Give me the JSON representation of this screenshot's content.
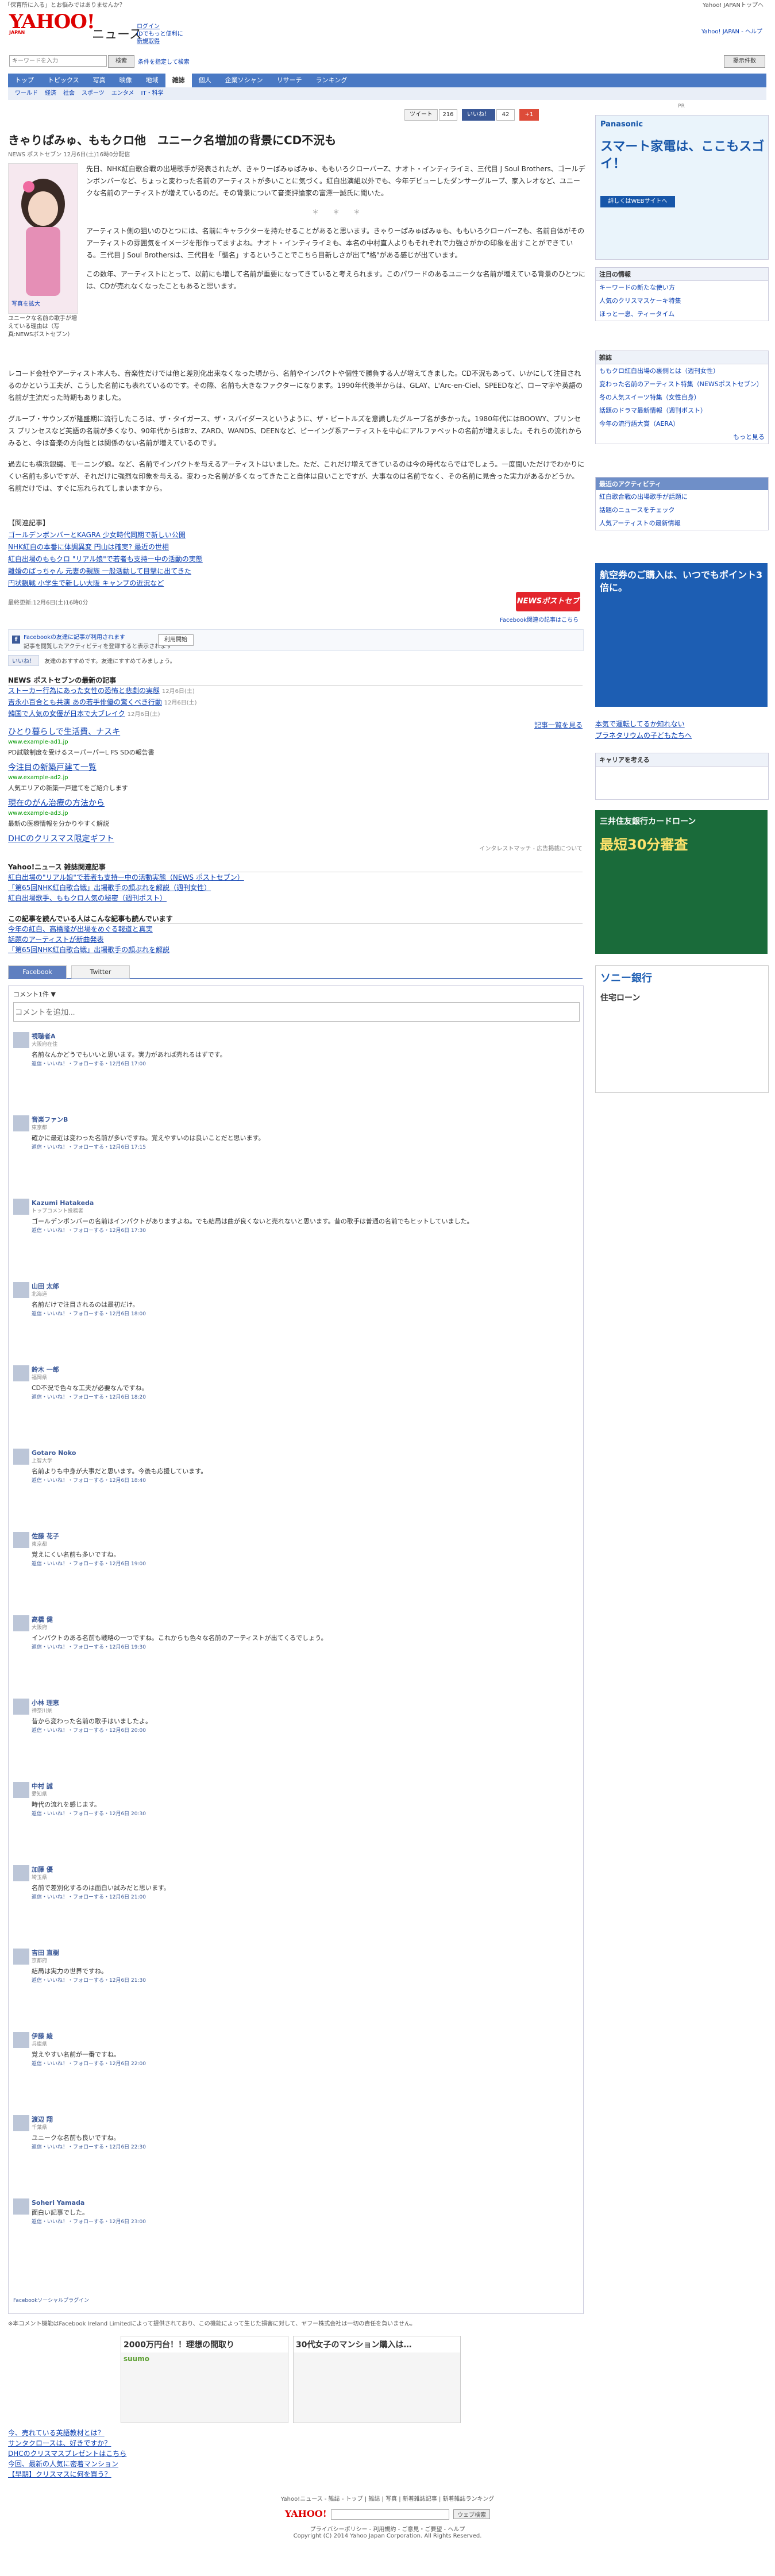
{
  "top_strip": {
    "left": "「保育所に入る」とお悩みではありませんか？",
    "right": "Yahoo! JAPANトップへ"
  },
  "header": {
    "logo": "YAHOO!",
    "logo_sub": "JAPAN",
    "section_title": "ニュース",
    "login": "ログイン",
    "login_sub": "IDでもっと便利に",
    "register": "新規取得",
    "right_links": "Yahoo! JAPAN - ヘルプ",
    "search_placeholder": "キーワードを入力",
    "search_button": "検索",
    "search_option": "条件を指定して検索",
    "search_right_button": "提示件数"
  },
  "nav": {
    "tabs": [
      "トップ",
      "トピックス",
      "写真",
      "映像",
      "地域",
      "雑誌",
      "個人",
      "企業ソシャン",
      "リサーチ",
      "ランキング"
    ],
    "active_index": 5,
    "sub": [
      "ワールド",
      "経済",
      "社会",
      "スポーツ",
      "エンタメ",
      "IT・科学"
    ]
  },
  "share": {
    "tweet": "ツイート",
    "tweet_count": "216",
    "like": "いいね！",
    "like_count": "42",
    "gplus": "+1"
  },
  "article": {
    "title": "きゃりぱみゅ、ももクロ他　ユニーク名増加の背景にCD不況も",
    "source": "NEWS ポストセブン 12月6日(土)16時0分配信",
    "caption": "ユニークな名前の歌手が増えている理由は（写真:NEWSポストセブン）",
    "photo_alt": "写真を拡大",
    "paras": [
      "先日、NHK紅白歌合戦の出場歌手が発表されたが、きゃりーぱみゅぱみゅ、ももいろクローバーZ、ナオト・インティライミ、三代目 J Soul Brothers、ゴールデンボンバーなど、ちょっと変わった名前のアーティストが多いことに気づく。紅白出演組以外でも、今年デビューしたダンサーグループ、家入レオなど、ユニークな名前のアーティストが増えているのだ。その背景について音楽評論家の富澤一誠氏に聞いた。",
      "アーティスト側の狙いのひとつには、名前にキャラクターを持たせることがあると思います。きゃりーぱみゅぱみゅも、ももいろクローバーZも、名前自体がそのアーティストの雰囲気をイメージを形作ってますよね。ナオト・インティライミも、本名の中村直人よりもそれぞれで力強さがかの印象を出すことができている。三代目 J Soul Brothersは、三代目を「襲名」するということでこちら目新しさが出て\"格\"がある感じが出ています。",
      "この数年、アーティストにとって、以前にも増して名前が重要になってきていると考えられます。このパワードのあるユニークな名前が増えている背景のひとつには、CDが売れなくなったこともあると思います。",
      "レコード会社やアーティスト本人も、音楽性だけでは他と差別化出来なくなった頃から、名前やインパクトや個性で勝負する人が増えてきました。CD不況もあって、いかにして注目されるのかという工夫が、こうした名前にも表れているのです。その際、名前も大きなファクターになります。1990年代後半からは、GLAY、L'Arc-en-Ciel、SPEEDなど、ローマ字や英語の名前が主流だった時期もありました。",
      "グループ・サウンズが隆盛期に流行したころは、ザ・タイガース、ザ・スパイダースというように、ザ・ビートルズを意識したグループ名が多かった。1980年代にはBOOWY、プリンセス プリンセスなど英語の名前が多くなり、90年代からはB'z、ZARD、WANDS、DEENなど、ビーイング系アーティストを中心にアルファベットの名前が増えました。それらの流れからみると、今は音楽の方向性とは関係のない名前が増えているのです。",
      "過去にも横浜銀蝿、モーニング娘。など、名前でインパクトを与えるアーティストはいました。ただ、これだけ増えてきているのは今の時代ならではでしょう。一度聞いただけでわかりにくい名前も多いですが、それだけに強烈な印象を与える。変わった名前が多くなってきたこと自体は良いことですが、大事なのは名前でなく、その名前に見合った実力があるかどうか。名前だけでは、すぐに忘れられてしまいますから。"
    ],
    "related_head": "【関連記事】",
    "related": [
      "ゴールデンボンバーとKAGRA 少女時代同期で新しい公開",
      "NHK紅白の本番に体調異変 円山は確実? 最近の世相",
      "紅白出場のももクロ \"リアル娘\"で若者も支持ー中の活動の実態",
      "離婚のぱっちゃん 元妻の親族 一般活動して目撃に出てきた",
      "円状観戦 小学生で新しい大阪 キャンプの近況など"
    ],
    "updated": "最終更新:12月6日(土)16時0分",
    "publisher_logo": "NEWSポストセブン",
    "fb_recommend": "Facebook関連の記事はこちら"
  },
  "fb_social": {
    "title": "Facebookの友達に記事が利用されます",
    "sub": "記事を閲覧したアクティビティを登録すると表示されます",
    "ok": "利用開始",
    "like_label": "いいね！",
    "like_text": "友達のおすすめです。友達にすすめてみましょう。"
  },
  "publisher_latest": {
    "heading": "NEWS ポストセブンの最新の記事",
    "items": [
      {
        "title": "ストーカー行為にあった女性の恐怖と悲劇の実態",
        "date": "12月6日(土)"
      },
      {
        "title": "吉永小百合とも共演 あの若手俳優の驚くべき行動",
        "date": "12月6日(土)"
      },
      {
        "title": "韓国で人気の女優が日本で大ブレイク",
        "date": "12月6日(土)"
      }
    ],
    "more": "記事一覧を見る"
  },
  "ads": [
    {
      "title": "ひとり暮らしで生活費、ナスキ",
      "url": "www.example-ad1.jp",
      "desc": "PD試験制度を受けるスーパーパーL FS SDの報告書"
    },
    {
      "title": "今注目の新築戸建て一覧",
      "url": "www.example-ad2.jp",
      "desc": "人気エリアの新築一戸建てをご紹介します"
    },
    {
      "title": "現在のがん治療の方法から",
      "url": "www.example-ad3.jp",
      "desc": "最新の医療情報を分かりやすく解説"
    },
    {
      "title": "DHCのクリスマス限定ギフト",
      "url": "",
      "desc": ""
    }
  ],
  "ads_footer": "インタレストマッチ - 広告掲載について",
  "magazine_related": {
    "heading": "Yahoo!ニュース 雑誌関連記事",
    "items": [
      "紅白出場の\"リアル娘\"で若者も支持ー中の活動実態（NEWS ポストセブン）",
      "「第65回NHK紅白歌合戦」出場歌手の顔ぶれを解説（週刊女性）",
      "紅白出場歌手、ももクロ人気の秘密（週刊ポスト）"
    ]
  },
  "also_read": {
    "heading": "この記事を読んでいる人はこんな記事も読んでいます",
    "items": [
      "今年の紅白、高橋隆が出場をめぐる報道と真実",
      "話題のアーティストが新曲発表",
      "「第65回NHK紅白歌合戦」出場歌手の顔ぶれを解説"
    ]
  },
  "comment_tabs": {
    "facebook": "Facebook",
    "twitter": "Twitter"
  },
  "comments": {
    "header": "コメント1件 ▼",
    "placeholder": "コメントを追加...",
    "fb_plugin": "Facebookソーシャルプラグイン",
    "items": [
      {
        "name": "視聴者A",
        "meta": "大阪府在住",
        "body": "名前なんかどうでもいいと思います。実力があれば売れるはずです。",
        "foot": "返信・いいね！・フォローする・12月6日 17:00"
      },
      {
        "name": "音楽ファンB",
        "meta": "東京都",
        "body": "確かに最近は変わった名前が多いですね。覚えやすいのは良いことだと思います。",
        "foot": "返信・いいね！・フォローする・12月6日 17:15"
      },
      {
        "name": "Kazumi Hatakeda",
        "meta": "トップコメント投稿者",
        "body": "ゴールデンボンバーの名前はインパクトがありますよね。でも結局は曲が良くないと売れないと思います。昔の歌手は普通の名前でもヒットしていました。",
        "foot": "返信・いいね！・フォローする・12月6日 17:30"
      },
      {
        "name": "山田 太郎",
        "meta": "北海道",
        "body": "名前だけで注目されるのは最初だけ。",
        "foot": "返信・いいね！・フォローする・12月6日 18:00"
      },
      {
        "name": "鈴木 一郎",
        "meta": "福岡県",
        "body": "CD不況で色々な工夫が必要なんですね。",
        "foot": "返信・いいね！・フォローする・12月6日 18:20"
      },
      {
        "name": "Gotaro Noko",
        "meta": "上智大学",
        "body": "名前よりも中身が大事だと思います。今後も応援しています。",
        "foot": "返信・いいね！・フォローする・12月6日 18:40"
      },
      {
        "name": "佐藤 花子",
        "meta": "東京都",
        "body": "覚えにくい名前も多いですね。",
        "foot": "返信・いいね！・フォローする・12月6日 19:00"
      },
      {
        "name": "高橋 健",
        "meta": "大阪府",
        "body": "インパクトのある名前も戦略の一つですね。これからも色々な名前のアーティストが出てくるでしょう。",
        "foot": "返信・いいね！・フォローする・12月6日 19:30"
      },
      {
        "name": "小林 理恵",
        "meta": "神奈川県",
        "body": "昔から変わった名前の歌手はいましたよ。",
        "foot": "返信・いいね！・フォローする・12月6日 20:00"
      },
      {
        "name": "中村 誠",
        "meta": "愛知県",
        "body": "時代の流れを感じます。",
        "foot": "返信・いいね！・フォローする・12月6日 20:30"
      },
      {
        "name": "加藤 優",
        "meta": "埼玉県",
        "body": "名前で差別化するのは面白い試みだと思います。",
        "foot": "返信・いいね！・フォローする・12月6日 21:00"
      },
      {
        "name": "吉田 直樹",
        "meta": "京都府",
        "body": "結局は実力の世界ですね。",
        "foot": "返信・いいね！・フォローする・12月6日 21:30"
      },
      {
        "name": "伊藤 綾",
        "meta": "兵庫県",
        "body": "覚えやすい名前が一番ですね。",
        "foot": "返信・いいね！・フォローする・12月6日 22:00"
      },
      {
        "name": "渡辺 翔",
        "meta": "千葉県",
        "body": "ユニークな名前も良いですね。",
        "foot": "返信・いいね！・フォローする・12月6日 22:30"
      },
      {
        "name": "Soheri Yamada",
        "meta": "",
        "body": "面白い記事でした。",
        "foot": "返信・いいね！・フォローする・12月6日 23:00"
      }
    ]
  },
  "notice": "※本コメント機能はFacebook Ireland Limitedによって提供されており、この機能によって生じた損害に対して、ヤフー株式会社は一切の責任を負いません。",
  "bottom_banners": [
    {
      "head": "2000万円台！！理想の間取り",
      "sub": "suumo"
    },
    {
      "head": "30代女子のマンション購入は…",
      "sub": ""
    }
  ],
  "pr_list": [
    "今、売れている英語教材とは？",
    "サンタクロースは、好きですか？",
    "DHCのクリスマスプレゼントはこちら",
    "今回、最新の人気に密着マンション",
    "【早期】クリスマスに何を買う？"
  ],
  "footer": {
    "links": "Yahoo!ニュース - 雑誌 - トップ | 雑誌 | 写真 | 新着雑誌記事 | 新着雑誌ランキング",
    "search_button": "ウェブ検索",
    "legal": "プライバシーポリシー - 利用規約 - ご意見・ご要望 - ヘルプ",
    "copyright": "Copyright (C) 2014 Yahoo Japan Corporation. All Rights Reserved."
  },
  "sidebar": {
    "pr_label": "PR",
    "panasonic": {
      "brand": "Panasonic",
      "headline": "スマート家電は、ここもスゴイ！",
      "button": "詳しくはWEBサイトへ"
    },
    "attention_heading": "注目の情報",
    "attention": [
      "キーワードの新たな使い方",
      "人気のクリスマスケーキ特集",
      "ほっと一息、ティータイム"
    ],
    "ranking_heading": "雑誌",
    "ranking": [
      "ももクロ紅白出場の裏側とは（週刊女性）",
      "変わった名前のアーティスト特集（NEWSポストセブン）",
      "冬の人気スイーツ特集（女性自身）",
      "話題のドラマ最新情報（週刊ポスト）",
      "今年の流行語大賞（AERA）"
    ],
    "ranking_more": "もっと見る",
    "recent_activity": "最近のアクティビティ",
    "activity": [
      "紅白歌合戦の出場歌手が話題に",
      "話題のニュースをチェック",
      "人気アーティストの最新情報"
    ],
    "card_ad": "航空券のご購入は、いつでもポイント3倍に。",
    "qa_links": [
      "本気で運転してるか知れない",
      "プラネタリウムの子どもたちへ"
    ],
    "career_heading": "キャリアを考える",
    "smbc": {
      "title": "三井住友銀行カードローン",
      "sub": "最短30分審査"
    },
    "bank": {
      "title": "ソニー銀行",
      "sub": "住宅ローン"
    }
  }
}
